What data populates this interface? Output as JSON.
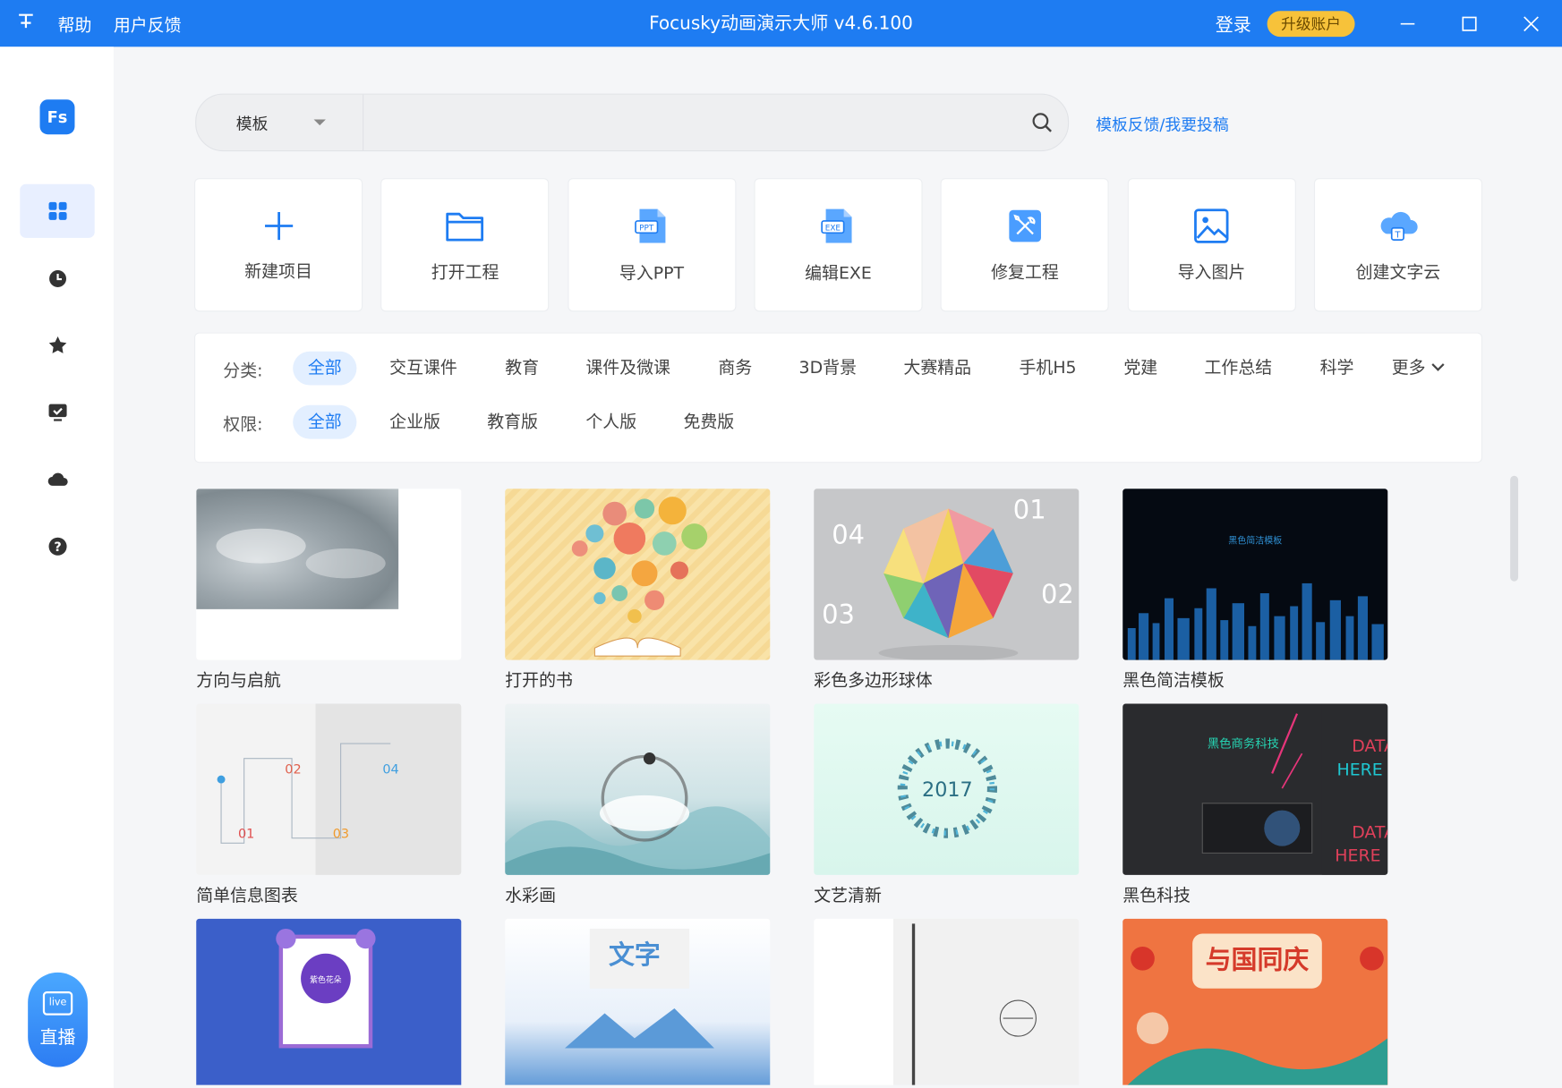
{
  "titlebar": {
    "app_icon": "pin-icon",
    "menu": [
      "帮助",
      "用户反馈"
    ],
    "title": "Focusky动画演示大师 v4.6.100",
    "login": "登录",
    "upgrade": "升级账户"
  },
  "sidebar": {
    "logo": "Fs",
    "items": [
      "grid-icon",
      "clock-icon",
      "star-icon",
      "monitor-check-icon",
      "cloud-icon",
      "help-icon"
    ],
    "live_label": "直播",
    "live_badge": "live"
  },
  "search": {
    "select_label": "模板",
    "placeholder": "",
    "feedback_link": "模板反馈/我要投稿"
  },
  "actions": [
    {
      "label": "新建项目",
      "icon": "plus-icon"
    },
    {
      "label": "打开工程",
      "icon": "folder-icon"
    },
    {
      "label": "导入PPT",
      "icon": "ppt-file-icon"
    },
    {
      "label": "编辑EXE",
      "icon": "exe-file-icon"
    },
    {
      "label": "修复工程",
      "icon": "repair-icon"
    },
    {
      "label": "导入图片",
      "icon": "image-icon"
    },
    {
      "label": "创建文字云",
      "icon": "cloud-text-icon"
    }
  ],
  "filters": {
    "category_label": "分类:",
    "categories": [
      "全部",
      "交互课件",
      "教育",
      "课件及微课",
      "商务",
      "3D背景",
      "大赛精品",
      "手机H5",
      "党建",
      "工作总结",
      "科学",
      "更多"
    ],
    "permission_label": "权限:",
    "permissions": [
      "全部",
      "企业版",
      "教育版",
      "个人版",
      "免费版"
    ],
    "active_category": "全部",
    "active_permission": "全部"
  },
  "templates": [
    {
      "title": "方向与启航"
    },
    {
      "title": "打开的书"
    },
    {
      "title": "彩色多边形球体",
      "numbers": [
        "01",
        "02",
        "03",
        "04"
      ]
    },
    {
      "title": "黑色简洁模板",
      "text": "黑色简洁模板"
    },
    {
      "title": "简单信息图表",
      "numbers": [
        "01",
        "02",
        "03",
        "04"
      ]
    },
    {
      "title": "水彩画"
    },
    {
      "title": "文艺清新",
      "year": "2017"
    },
    {
      "title": "黑色科技",
      "headline": "黑色商务科技",
      "side_text": [
        "DATA",
        "HERE",
        "DATA",
        "HERE"
      ]
    },
    {
      "title": "",
      "text": "紫色花朵"
    },
    {
      "title": "",
      "text": "文字"
    },
    {
      "title": ""
    },
    {
      "title": "",
      "text": "与国同庆"
    }
  ],
  "colors": {
    "brand": "#1e7cf2",
    "upgrade": "#f7c23a",
    "active_filter_bg": "#e3efff"
  }
}
